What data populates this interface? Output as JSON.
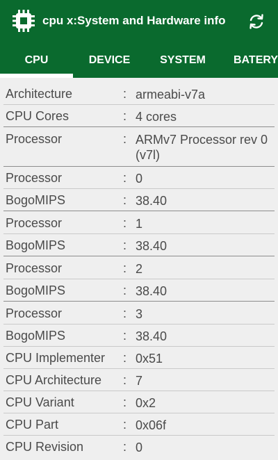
{
  "app": {
    "title": "cpu x:System and Hardware info",
    "icon": "chip-icon",
    "accent_color": "#0a6a2e"
  },
  "tabs": [
    {
      "label": "CPU",
      "selected": true
    },
    {
      "label": "DEVICE",
      "selected": false
    },
    {
      "label": "SYSTEM",
      "selected": false
    },
    {
      "label": "BATERY",
      "selected": false
    }
  ],
  "separator": ":",
  "rows": [
    {
      "label": "Architecture",
      "value": "armeabi-v7a"
    },
    {
      "label": "CPU Cores",
      "value": "4 cores"
    },
    {
      "label": "Processor",
      "value": "ARMv7 Processor rev 0 (v7l)"
    },
    {
      "label": "Processor",
      "value": "0"
    },
    {
      "label": "BogoMIPS",
      "value": "38.40"
    },
    {
      "label": "Processor",
      "value": "1"
    },
    {
      "label": "BogoMIPS",
      "value": "38.40"
    },
    {
      "label": "Processor",
      "value": "2"
    },
    {
      "label": "BogoMIPS",
      "value": "38.40"
    },
    {
      "label": "Processor",
      "value": "3"
    },
    {
      "label": "BogoMIPS",
      "value": "38.40"
    },
    {
      "label": "CPU Implementer",
      "value": "0x51"
    },
    {
      "label": "CPU Architecture",
      "value": "7"
    },
    {
      "label": "CPU Variant",
      "value": "0x2"
    },
    {
      "label": "CPU Part",
      "value": "0x06f"
    },
    {
      "label": "CPU Revision",
      "value": "0"
    }
  ]
}
